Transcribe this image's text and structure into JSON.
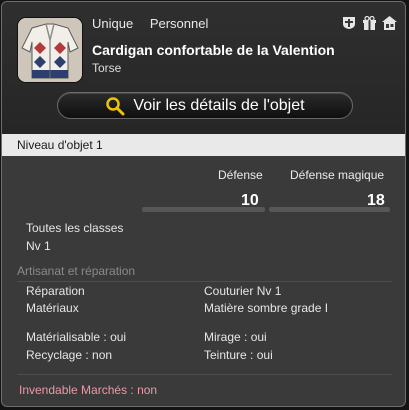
{
  "header": {
    "tags": [
      "Unique",
      "Personnel"
    ],
    "item_name": "Cardigan confortable de la Valention",
    "category": "Torse",
    "icons": [
      "cross-shield-icon",
      "gift-box-icon",
      "market-house-icon"
    ],
    "details_button": "Voir les détails de l'objet"
  },
  "item_level": "Niveau d'objet 1",
  "stats": [
    {
      "label": "Défense",
      "value": "10"
    },
    {
      "label": "Défense magique",
      "value": "18"
    }
  ],
  "classes": "Toutes les classes",
  "level": "Nv 1",
  "crafting": {
    "title": "Artisanat et réparation",
    "repair_label": "Réparation",
    "repair_value": "Couturier Nv 1",
    "materials_label": "Matériaux",
    "materials_value": "Matière sombre grade I",
    "materia_label": "Matérialisable",
    "materia_value": "oui",
    "glamour_label": "Mirage",
    "glamour_value": "oui",
    "desynth_label": "Recyclage",
    "desynth_value": "non",
    "dye_label": "Teinture",
    "dye_value": "oui",
    "separator": " : "
  },
  "market": "Invendable Marchés : non",
  "colors": {
    "market_text": "#e99aa8",
    "level_bar": "#e9e9e9",
    "panel": "#3a3a3a"
  }
}
